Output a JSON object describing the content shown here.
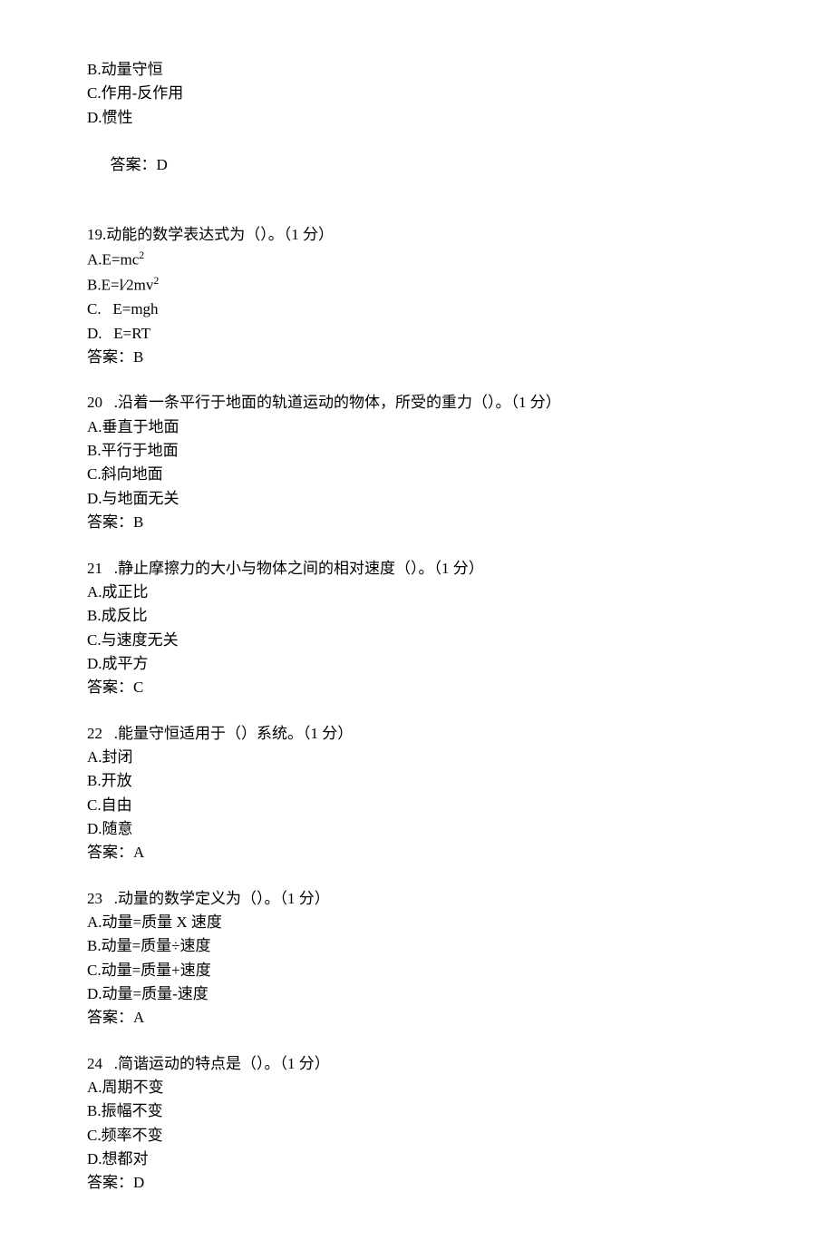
{
  "pre_options": [
    "B.动量守恒",
    "C.作用-反作用",
    "D.惯性"
  ],
  "pre_answer_label": "答案：",
  "pre_answer": "D",
  "questions": [
    {
      "number": "19.",
      "stem": "动能的数学表达式为（）。（1 分）",
      "options": [
        {
          "key": "A.",
          "text_prefix": "E=mc",
          "sup": "2",
          "text_suffix": ""
        },
        {
          "key": "B.",
          "text_prefix": "E=l⁄2mv",
          "sup": "2",
          "text_suffix": ""
        },
        {
          "key": "C.   ",
          "text_prefix": "E=mgh",
          "sup": "",
          "text_suffix": ""
        },
        {
          "key": "D.   ",
          "text_prefix": "E=RT",
          "sup": "",
          "text_suffix": ""
        }
      ],
      "answer_label": "答案：",
      "answer": "B"
    },
    {
      "number": "20",
      "stem": "   .沿着一条平行于地面的轨道运动的物体，所受的重力（）。（1 分）",
      "options": [
        {
          "key": "A.",
          "text_prefix": "垂直于地面",
          "sup": "",
          "text_suffix": ""
        },
        {
          "key": "B.",
          "text_prefix": "平行于地面",
          "sup": "",
          "text_suffix": ""
        },
        {
          "key": "C.",
          "text_prefix": "斜向地面",
          "sup": "",
          "text_suffix": ""
        },
        {
          "key": "D.",
          "text_prefix": "与地面无关",
          "sup": "",
          "text_suffix": ""
        }
      ],
      "answer_label": "答案：",
      "answer": "B"
    },
    {
      "number": "21",
      "stem": "   .静止摩擦力的大小与物体之间的相对速度（）。（1 分）",
      "options": [
        {
          "key": "A.",
          "text_prefix": "成正比",
          "sup": "",
          "text_suffix": ""
        },
        {
          "key": "B.",
          "text_prefix": "成反比",
          "sup": "",
          "text_suffix": ""
        },
        {
          "key": "C.",
          "text_prefix": "与速度无关",
          "sup": "",
          "text_suffix": ""
        },
        {
          "key": "D.",
          "text_prefix": "成平方",
          "sup": "",
          "text_suffix": ""
        }
      ],
      "answer_label": "答案：",
      "answer": "C"
    },
    {
      "number": "22",
      "stem": "   .能量守恒适用于（）系统。（1 分）",
      "options": [
        {
          "key": "A.",
          "text_prefix": "封闭",
          "sup": "",
          "text_suffix": ""
        },
        {
          "key": "B.",
          "text_prefix": "开放",
          "sup": "",
          "text_suffix": ""
        },
        {
          "key": "C.",
          "text_prefix": "自由",
          "sup": "",
          "text_suffix": ""
        },
        {
          "key": "D.",
          "text_prefix": "随意",
          "sup": "",
          "text_suffix": ""
        }
      ],
      "answer_label": "答案：",
      "answer": "A"
    },
    {
      "number": "23",
      "stem": "   .动量的数学定义为（）。（1 分）",
      "options": [
        {
          "key": "A.",
          "text_prefix": "动量=质量 X 速度",
          "sup": "",
          "text_suffix": ""
        },
        {
          "key": "B.",
          "text_prefix": "动量=质量÷速度",
          "sup": "",
          "text_suffix": ""
        },
        {
          "key": "C.",
          "text_prefix": "动量=质量+速度",
          "sup": "",
          "text_suffix": ""
        },
        {
          "key": "D.",
          "text_prefix": "动量=质量-速度",
          "sup": "",
          "text_suffix": ""
        }
      ],
      "answer_label": "答案：",
      "answer": "A"
    },
    {
      "number": "24",
      "stem": "   .简谐运动的特点是（）。（1 分）",
      "options": [
        {
          "key": "A.",
          "text_prefix": "周期不变",
          "sup": "",
          "text_suffix": ""
        },
        {
          "key": "B.",
          "text_prefix": "振幅不变",
          "sup": "",
          "text_suffix": ""
        },
        {
          "key": "C.",
          "text_prefix": "频率不变",
          "sup": "",
          "text_suffix": ""
        },
        {
          "key": "D.",
          "text_prefix": "想都对",
          "sup": "",
          "text_suffix": ""
        }
      ],
      "answer_label": "答案：",
      "answer": "D"
    }
  ]
}
